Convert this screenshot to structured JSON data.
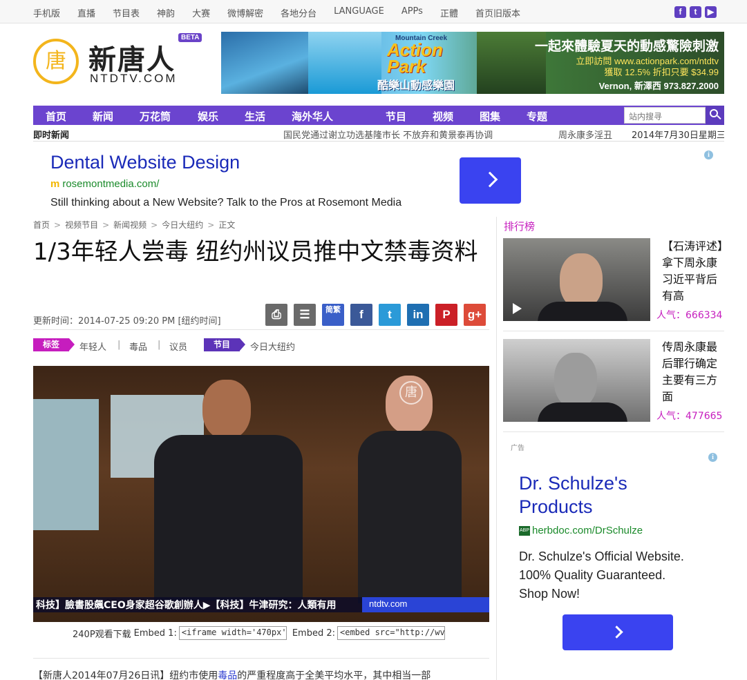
{
  "topbar": {
    "links": [
      "手机版",
      "直播",
      "节目表",
      "神韵",
      "大赛",
      "微博解密",
      "各地分台",
      "LANGUAGE",
      "APPs",
      "正體",
      "首页旧版本"
    ],
    "social": [
      {
        "icon": "facebook-icon",
        "glyph": "f"
      },
      {
        "icon": "twitter-icon",
        "glyph": "t"
      },
      {
        "icon": "youtube-icon",
        "glyph": "▶"
      }
    ]
  },
  "logo": {
    "seal": "唐",
    "cn": "新唐人",
    "en": "NTDTV.COM",
    "beta": "BETA"
  },
  "banner": {
    "brand_small": "Mountain Creek",
    "brand_big": "Action Park",
    "brand_cn": "酷樂山動感樂園",
    "headline": "一起來體驗夏天的動感驚險刺激",
    "line2": "立即訪問 www.actionpark.com/ntdtv",
    "line3": "獲取 12.5% 折扣只要 $34.99",
    "line4": "Vernon, 新澤西 973.827.2000"
  },
  "nav": {
    "items": [
      "首页",
      "新闻",
      "万花筒",
      "娱乐",
      "生活",
      "海外华人",
      "节目",
      "视频",
      "图集",
      "专题"
    ],
    "search_placeholder": "站内搜寻"
  },
  "ticker": {
    "label": "即时新闻",
    "news1": "国民党通过谢立功选基隆市长 不放弃和黄景泰再协调",
    "news2": "周永康多淫丑",
    "date": "2014年7月30日星期三"
  },
  "ad_top": {
    "title": "Dental Website Design",
    "url": "rosemontmedia.com/",
    "desc": "Still thinking about a New Website? Talk to the Pros at Rosemont Media"
  },
  "breadcrumb": [
    "首页",
    "视频节目",
    "新闻视频",
    "今日大纽约",
    "正文"
  ],
  "article": {
    "headline": "1/3年轻人尝毒 纽约州议员推中文禁毒资料",
    "updated": "更新时间：2014-07-25 09:20 PM [纽约时间]",
    "share": [
      {
        "name": "print-icon",
        "glyph": "⎙",
        "color": "#6a6a6a"
      },
      {
        "name": "comment-icon",
        "glyph": "☰",
        "color": "#6a6a6a"
      },
      {
        "name": "simplified-traditional-icon",
        "glyph": "简繁",
        "color": "#3a5fc8"
      },
      {
        "name": "facebook-icon",
        "glyph": "f",
        "color": "#3b5998"
      },
      {
        "name": "twitter-icon",
        "glyph": "t",
        "color": "#2b9ad8"
      },
      {
        "name": "linkedin-icon",
        "glyph": "in",
        "color": "#1f6fb2"
      },
      {
        "name": "pinterest-icon",
        "glyph": "P",
        "color": "#cb2027"
      },
      {
        "name": "googleplus-icon",
        "glyph": "g+",
        "color": "#dd4b39"
      }
    ],
    "tag_label": "标签",
    "tags": [
      "年轻人",
      "毒品",
      "议员"
    ],
    "program_label": "节目",
    "program": "今日大纽约",
    "video_crawl": "科技】臉書股飆CEO身家超谷歌創辦人▶【科技】牛津研究：人類有用",
    "video_brand": "ntdtv.com",
    "embed_label": "240P观看下载",
    "embed1_label": "Embed 1:",
    "embed1_value": "<iframe width='470px'",
    "embed2_label": "Embed 2:",
    "embed2_value": "<embed src=\"http://wv",
    "lead_prefix": "【新唐人2014年07月26日讯】纽约市使用",
    "lead_link": "毒品",
    "lead_suffix": "的严重程度高于全美平均水平，其中相当一部"
  },
  "sidebar": {
    "title": "排行榜",
    "cards": [
      {
        "title": "【石涛评述】拿下周永康 习近平背后有高",
        "pop_label": "人气：",
        "pop": "666334"
      },
      {
        "title": "传周永康最后罪行确定 主要有三方面",
        "pop_label": "人气：",
        "pop": "477665"
      }
    ],
    "ad_label": "广告",
    "ad": {
      "title": "Dr. Schulze's Products",
      "url": "herbdoc.com/DrSchulze",
      "desc": "Dr. Schulze's Official Website. 100% Quality Guaranteed. Shop Now!"
    }
  }
}
